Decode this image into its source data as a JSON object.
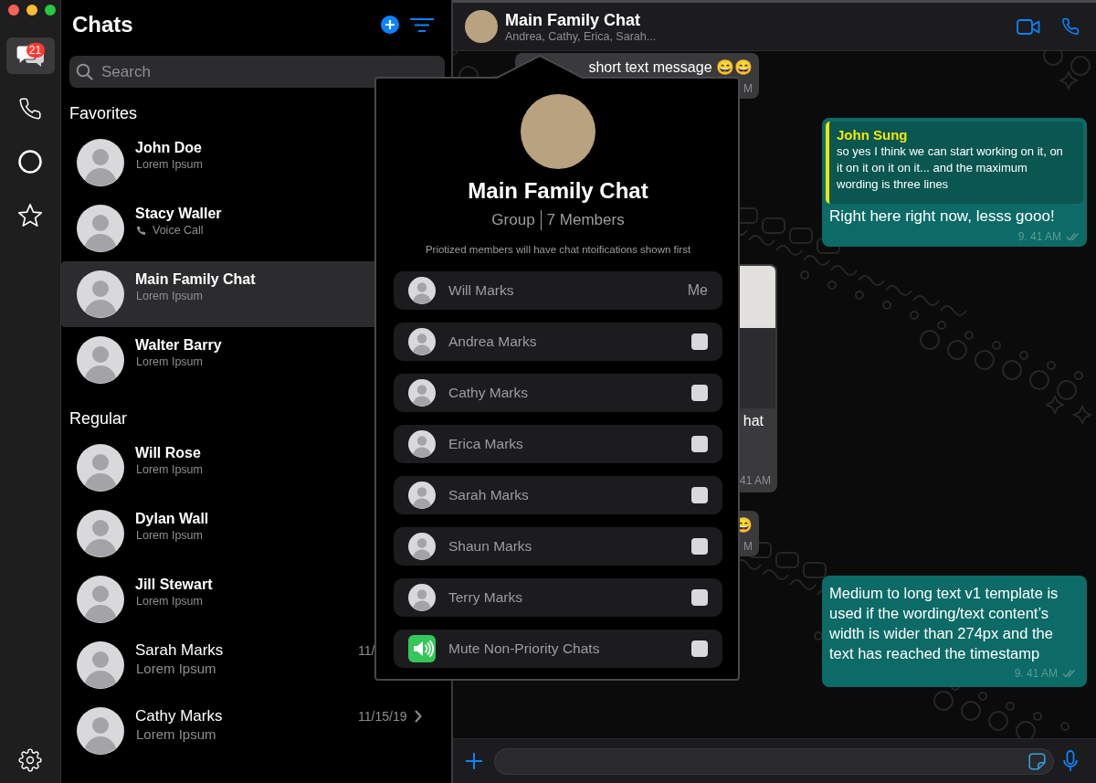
{
  "window_controls": [
    {
      "color": "#ff5f57"
    },
    {
      "color": "#febc2e"
    },
    {
      "color": "#28c840"
    }
  ],
  "rail": {
    "items": [
      {
        "kind": "chats",
        "selected": true,
        "badge": "21"
      },
      {
        "kind": "calls",
        "selected": false
      },
      {
        "kind": "status",
        "selected": false
      },
      {
        "kind": "starred",
        "selected": false
      }
    ]
  },
  "chat_list": {
    "title": "Chats",
    "search": {
      "placeholder": "Search"
    },
    "sections": [
      {
        "title": "Favorites",
        "chats": [
          {
            "name": "John Doe",
            "subtitle": "Lorem Ipsum",
            "unread": true,
            "call": false,
            "selected": false
          },
          {
            "name": "Stacy Waller",
            "subtitle": "Voice Call",
            "unread": true,
            "call": true,
            "selected": false
          },
          {
            "name": "Main Family Chat",
            "subtitle": "Lorem Ipsum",
            "unread": true,
            "call": false,
            "selected": true
          },
          {
            "name": "Walter Barry",
            "subtitle": "Lorem Ipsum",
            "unread": true,
            "call": false,
            "selected": false
          }
        ]
      },
      {
        "title": "Regular",
        "chats": [
          {
            "name": "Will Rose",
            "subtitle": "Lorem Ipsum",
            "unread": true,
            "call": false,
            "selected": false
          },
          {
            "name": "Dylan Wall",
            "subtitle": "Lorem Ipsum",
            "unread": true,
            "call": false,
            "selected": false
          },
          {
            "name": "Jill Stewart",
            "subtitle": "Lorem Ipsum",
            "unread": true,
            "call": false,
            "selected": false
          },
          {
            "name": "Sarah Marks",
            "subtitle": "Lorem Ipsum",
            "date": "11/",
            "unread": false,
            "call": false,
            "selected": false
          },
          {
            "name": "Cathy Marks",
            "subtitle": "Lorem Ipsum",
            "date": "11/15/19",
            "unread": false,
            "call": false,
            "selected": false,
            "chevron": true
          }
        ]
      }
    ]
  },
  "conversation": {
    "title": "Main Family Chat",
    "subtitle": "Andrea, Cathy, Erica, Sarah...",
    "messages": [
      {
        "outgoing": false,
        "kind": "text",
        "text": "short text message 😄😄",
        "time": "M"
      },
      {
        "outgoing": true,
        "kind": "reply",
        "quote_author": "John Sung",
        "quote": "so yes I think we can start working on it, on it on it on it on it... and the maximum wording is three lines",
        "text": "Right here right now, lesss gooo!",
        "time": "9. 41 AM"
      },
      {
        "outgoing": false,
        "kind": "photo",
        "text": "hat",
        "time": "41 AM"
      },
      {
        "outgoing": false,
        "kind": "text",
        "text": "😄",
        "time": "M"
      },
      {
        "outgoing": true,
        "kind": "text",
        "text": "Medium to long text v1 template is used if the wording/text content’s width is wider than 274px and the text has reached the timestamp",
        "time": "9. 41 AM"
      }
    ]
  },
  "group_info": {
    "title": "Main Family Chat",
    "type": "Group",
    "member_count": "7 Members",
    "note": "Priotized members will have chat ntoifications shown first",
    "rows": [
      {
        "kind": "self",
        "name": "Will Marks",
        "tag": "Me"
      },
      {
        "kind": "member",
        "name": "Andrea Marks",
        "checked": false
      },
      {
        "kind": "member",
        "name": "Cathy Marks",
        "checked": false
      },
      {
        "kind": "member",
        "name": "Erica Marks",
        "checked": false
      },
      {
        "kind": "member",
        "name": "Sarah Marks",
        "checked": false
      },
      {
        "kind": "member",
        "name": "Shaun Marks",
        "checked": false
      },
      {
        "kind": "member",
        "name": "Terry Marks",
        "checked": false
      },
      {
        "kind": "setting",
        "name": "Mute Non-Priority Chats",
        "checked": false
      }
    ]
  }
}
